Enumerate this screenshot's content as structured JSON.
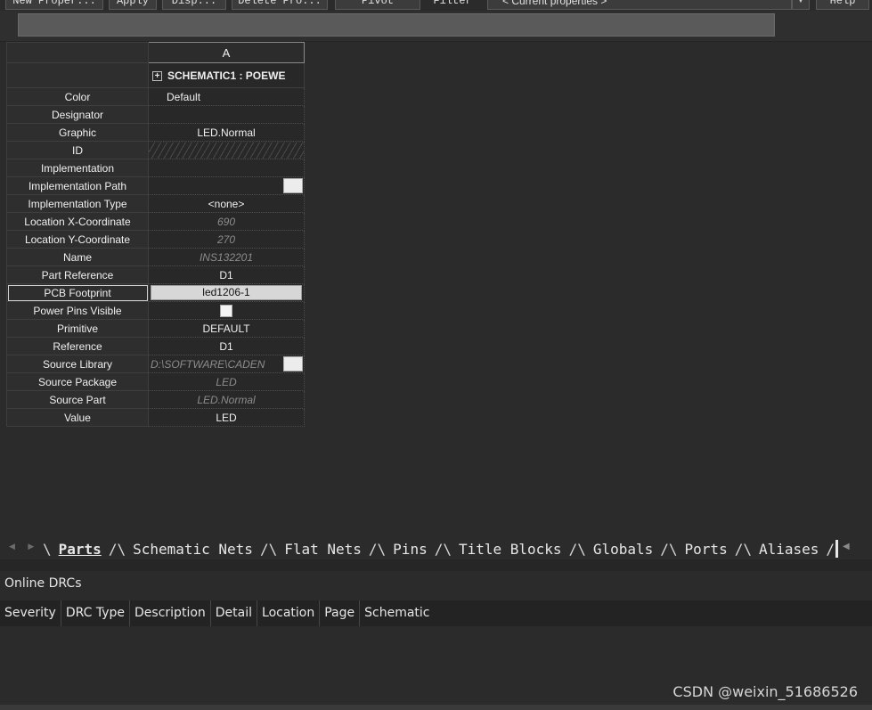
{
  "toolbar": {
    "buttons": [
      "New Proper...",
      "Apply",
      "Disp...",
      "Delete Pro...",
      "Pivot",
      "Filter",
      "Help"
    ],
    "filter_value": "< Current properties >"
  },
  "grid": {
    "column_header": "A",
    "part_name": "SCHEMATIC1 : POEWE",
    "rows": [
      {
        "name": "Color",
        "value": "Default"
      },
      {
        "name": "Designator",
        "value": ""
      },
      {
        "name": "Graphic",
        "value": "LED.Normal"
      },
      {
        "name": "ID",
        "value": ""
      },
      {
        "name": "Implementation",
        "value": ""
      },
      {
        "name": "Implementation Path",
        "value": ""
      },
      {
        "name": "Implementation Type",
        "value": "<none>"
      },
      {
        "name": "Location X-Coordinate",
        "value": "690"
      },
      {
        "name": "Location Y-Coordinate",
        "value": "270"
      },
      {
        "name": "Name",
        "value": "INS132201"
      },
      {
        "name": "Part Reference",
        "value": "D1"
      },
      {
        "name": "PCB Footprint",
        "value": "led1206-1"
      },
      {
        "name": "Power Pins Visible",
        "value": ""
      },
      {
        "name": "Primitive",
        "value": "DEFAULT"
      },
      {
        "name": "Reference",
        "value": "D1"
      },
      {
        "name": "Source Library",
        "value": "D:\\SOFTWARE\\CADEN"
      },
      {
        "name": "Source Package",
        "value": "LED"
      },
      {
        "name": "Source Part",
        "value": "LED.Normal"
      },
      {
        "name": "Value",
        "value": "LED"
      }
    ]
  },
  "tabs": [
    "Parts",
    "Schematic Nets",
    "Flat Nets",
    "Pins",
    "Title Blocks",
    "Globals",
    "Ports",
    "Aliases"
  ],
  "drc": {
    "title": "Online DRCs",
    "columns": [
      "Severity",
      "DRC Type",
      "Description",
      "Detail",
      "Location",
      "Page",
      "Schematic"
    ]
  },
  "watermark": "CSDN @weixin_51686526"
}
